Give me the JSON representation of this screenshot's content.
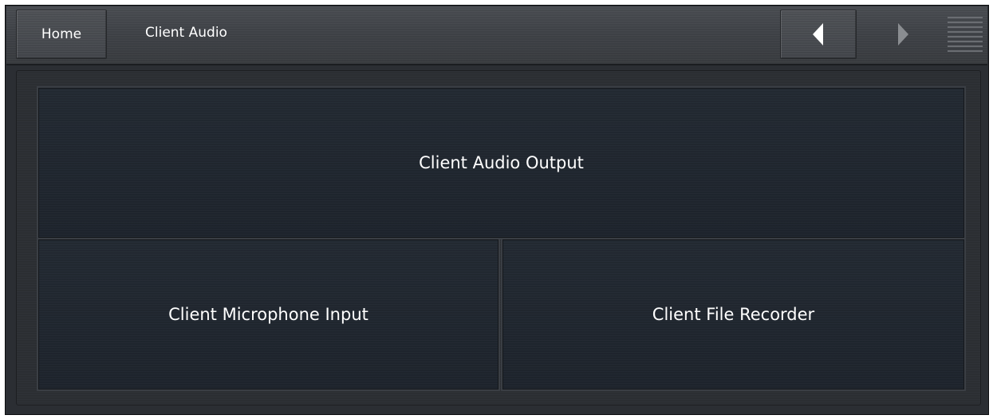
{
  "header": {
    "home_label": "Home",
    "title": "Client Audio",
    "back_icon": "chevron-left-icon",
    "forward_icon": "chevron-right-icon",
    "menu_icon": "hamburger-menu-icon"
  },
  "tiles": [
    {
      "label": "Client Audio Output"
    },
    {
      "label": "Client Microphone Input"
    },
    {
      "label": "Client File Recorder"
    }
  ],
  "colors": {
    "background": "#2b2e33",
    "tile": "#1f252e",
    "text": "#ffffff",
    "back_arrow": "#ffffff",
    "forward_arrow": "#8a8d91"
  }
}
